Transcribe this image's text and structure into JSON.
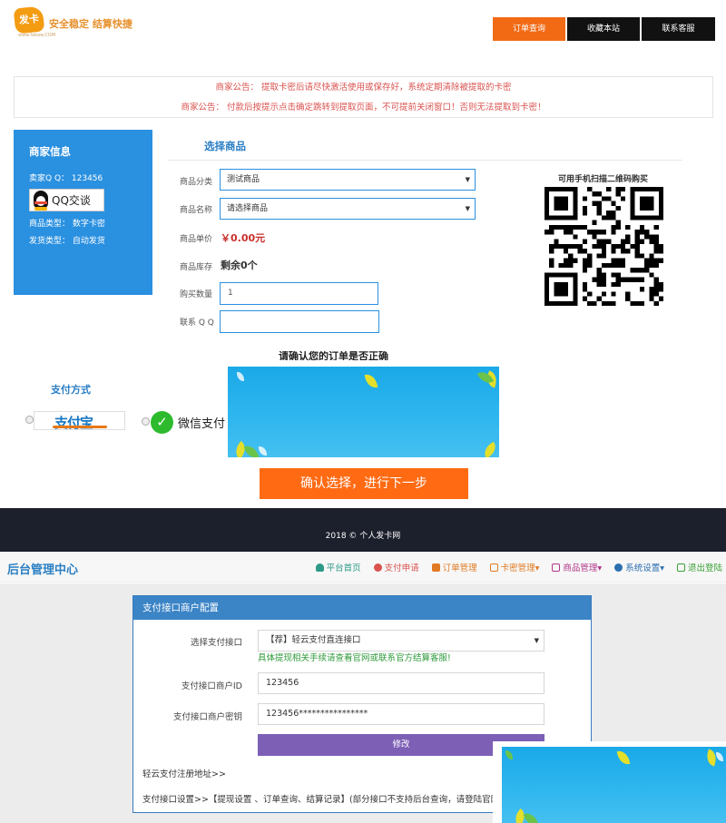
{
  "store": {
    "logo_badge": "发卡网",
    "logo_slogan": "安全稳定  结算快捷",
    "logo_url": "www.fakaw.COM",
    "nav": [
      {
        "label": "订单查询"
      },
      {
        "label": "收藏本站"
      },
      {
        "label": "联系客服"
      }
    ],
    "notices": [
      "商家公告： 提取卡密后请尽快激活使用或保存好，系统定期清除被提取的卡密",
      "商家公告： 付款后按提示点击确定跳转到提取页面，不可提前关闭窗口！否则无法提取到卡密！"
    ],
    "merchant": {
      "title": "商家信息",
      "seller_qq": "卖家Q Q：  123456",
      "qq_button": "QQ交谈",
      "product_type": "商品类型：  数字卡密",
      "delivery_type": "发货类型：  自动发货"
    },
    "form": {
      "title": "选择商品",
      "category_label": "商品分类",
      "category_value": "测试商品",
      "name_label": "商品名称",
      "name_value": "请选择商品",
      "price_label": "商品单价",
      "price_value": "￥0.00元",
      "stock_label": "商品库存",
      "stock_value": "剩余0个",
      "quantity_label": "购买数量",
      "quantity_value": "1",
      "qq_label": "联系 Q Q",
      "qq_value": ""
    },
    "qr_title": "可用手机扫描二维码购买",
    "cut_off_text": "请确认您的订单是否正确",
    "payment": {
      "title": "支付方式",
      "alipay": "支付宝",
      "wechat": "微信支付"
    },
    "confirm_button": "确认选择，进行下一步",
    "footer": "2018 © 个人发卡网"
  },
  "admin": {
    "title": "后台管理中心",
    "nav": [
      {
        "label": "平台首页",
        "color": "#2e9a8a"
      },
      {
        "label": "支付申请",
        "color": "#d9534f"
      },
      {
        "label": "订单管理",
        "color": "#e07b24"
      },
      {
        "label": "卡密管理▾",
        "color": "#e07b24"
      },
      {
        "label": "商品管理▾",
        "color": "#b0368a"
      },
      {
        "label": "系统设置▾",
        "color": "#2b6fb0"
      },
      {
        "label": "退出登陆",
        "color": "#39a035"
      }
    ],
    "panel": {
      "title": "支付接口商户配置",
      "interface_label": "选择支付接口",
      "interface_value": "【荐】轻云支付直连接口",
      "hint": "具体提现相关手续请查看官网或联系官方结算客服!",
      "merchant_id_label": "支付接口商户ID",
      "merchant_id_value": "123456",
      "merchant_key_label": "支付接口商户密钥",
      "merchant_key_value": "123456****************",
      "submit": "修改",
      "register_link": "轻云支付注册地址>>",
      "settings_text": "支付接口设置>>【提现设置 、订单查询、结算记录】(部分接口不支持后台查询，请登陆官网查询)"
    }
  },
  "colors": {
    "accent_orange": "#f26a14",
    "brand_blue": "#2a90e0",
    "notice_red": "#d9534f",
    "footer_dark": "#1c1f2c",
    "admin_panel_blue": "#3b84c6",
    "submit_purple": "#7d5fb6"
  }
}
